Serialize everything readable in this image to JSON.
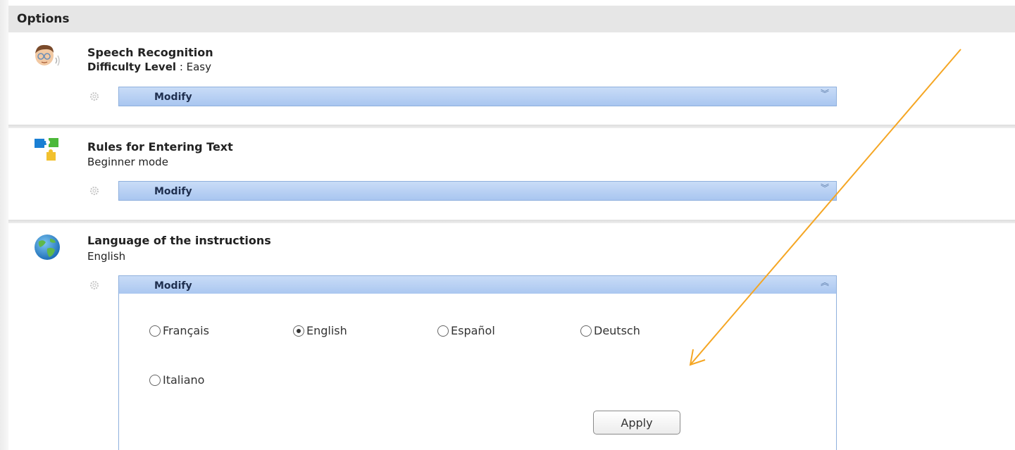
{
  "header": {
    "title": "Options"
  },
  "sections": [
    {
      "title": "Speech Recognition",
      "detail_label": "Difficulty Level",
      "detail_value": ": Easy",
      "modify_label": "Modify",
      "icon": "person-speaking-icon",
      "expanded": false
    },
    {
      "title": "Rules for Entering Text",
      "detail_value": "Beginner mode",
      "modify_label": "Modify",
      "icon": "puzzle-pieces-icon",
      "expanded": false
    },
    {
      "title": "Language of the instructions",
      "detail_value": "English",
      "modify_label": "Modify",
      "icon": "globe-icon",
      "expanded": true
    }
  ],
  "language_options": [
    {
      "label": "Français",
      "checked": false
    },
    {
      "label": "English",
      "checked": true
    },
    {
      "label": "Español",
      "checked": false
    },
    {
      "label": "Deutsch",
      "checked": false
    },
    {
      "label": "Italiano",
      "checked": false
    }
  ],
  "apply_label": "Apply",
  "colors": {
    "header_bg": "#e6e6e6",
    "modify_bar": "#b8d0f4",
    "annotation_arrow": "#f5a623"
  }
}
